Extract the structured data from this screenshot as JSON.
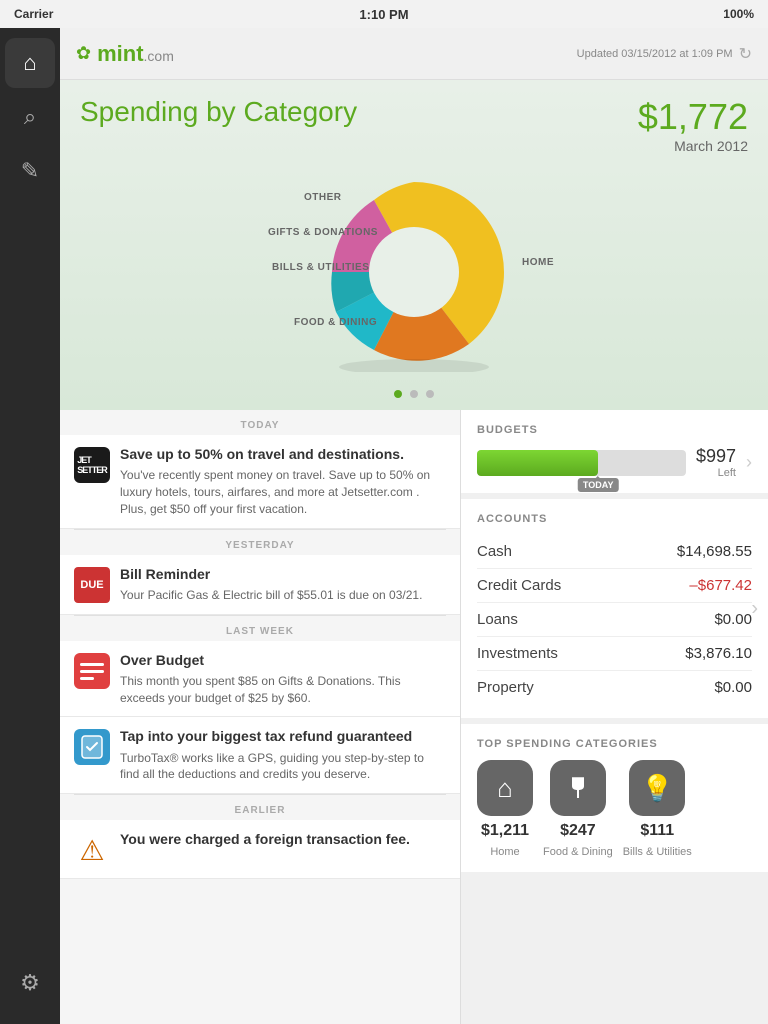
{
  "statusBar": {
    "carrier": "Carrier",
    "time": "1:10 PM",
    "battery": "100%"
  },
  "header": {
    "logo": "mint",
    "logoExt": ".com",
    "updated": "Updated 03/15/2012 at 1:09 PM"
  },
  "chart": {
    "title": "Spending by Category",
    "amount": "$1,772",
    "date": "March 2012",
    "labels": {
      "other": "OTHER",
      "gifts": "GIFTS & DONATIONS",
      "bills": "BILLS & UTILITIES",
      "food": "FOOD & DINING",
      "home": "HOME"
    }
  },
  "sidebar": {
    "items": [
      {
        "icon": "⌂",
        "name": "home",
        "active": true
      },
      {
        "icon": "⌕",
        "name": "search",
        "active": false
      },
      {
        "icon": "✎",
        "name": "compose",
        "active": false
      },
      {
        "icon": "⚙",
        "name": "settings",
        "active": false
      }
    ]
  },
  "feed": {
    "sections": [
      {
        "label": "TODAY",
        "items": [
          {
            "type": "jetsetter",
            "iconLabel": "JETSETTER",
            "title": "Save up to 50% on travel and destinations.",
            "desc": "You've recently spent money on travel. Save up to 50% on luxury hotels, tours, airfares, and more at Jetsetter.com . Plus, get $50 off your first vacation."
          }
        ]
      },
      {
        "label": "YESTERDAY",
        "items": [
          {
            "type": "bill",
            "iconLabel": "DUE",
            "title": "Bill Reminder",
            "desc": "Your Pacific Gas & Electric bill of $55.01 is due on 03/21."
          }
        ]
      },
      {
        "label": "LAST WEEK",
        "items": [
          {
            "type": "budget",
            "iconLabel": "≡",
            "title": "Over Budget",
            "desc": "This month you spent $85 on Gifts & Donations. This exceeds your budget of $25 by $60."
          },
          {
            "type": "tax",
            "iconLabel": "✓",
            "title": "Tap into your biggest tax refund guaranteed",
            "desc": "TurboTax® works like a GPS, guiding you step-by-step to find all the deductions and credits you deserve."
          }
        ]
      },
      {
        "label": "EARLIER",
        "items": [
          {
            "type": "warning",
            "iconLabel": "⚠",
            "title": "You were charged a foreign transaction fee.",
            "desc": ""
          }
        ]
      }
    ]
  },
  "budgets": {
    "sectionTitle": "BUDGETS",
    "amount": "$997",
    "amountLabel": "Left",
    "todayLabel": "TODAY",
    "fillPercent": 58
  },
  "accounts": {
    "sectionTitle": "ACCOUNTS",
    "rows": [
      {
        "name": "Cash",
        "value": "$14,698.55",
        "negative": false
      },
      {
        "name": "Credit Cards",
        "value": "–$677.42",
        "negative": true
      },
      {
        "name": "Loans",
        "value": "$0.00",
        "negative": false
      },
      {
        "name": "Investments",
        "value": "$3,876.10",
        "negative": false
      },
      {
        "name": "Property",
        "value": "$0.00",
        "negative": false
      }
    ]
  },
  "topSpending": {
    "sectionTitle": "TOP SPENDING CATEGORIES",
    "categories": [
      {
        "icon": "⌂",
        "amount": "$1,211",
        "label": "Home"
      },
      {
        "icon": "✕",
        "amount": "$247",
        "label": "Food & Dining"
      },
      {
        "icon": "💡",
        "amount": "$111",
        "label": "Bills & Utilities"
      }
    ]
  }
}
